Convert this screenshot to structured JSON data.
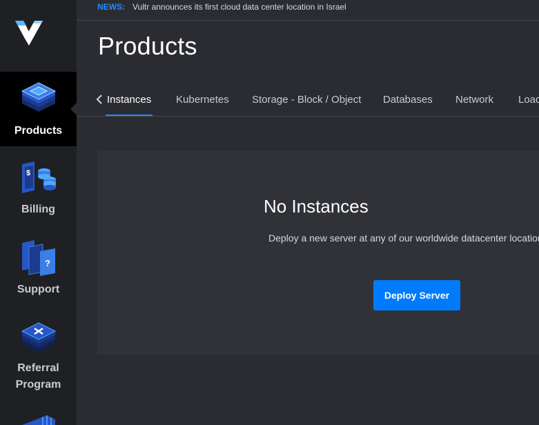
{
  "news": {
    "label": "NEWS:",
    "text": "Vultr announces its first cloud data center location in Israel"
  },
  "page": {
    "title": "Products"
  },
  "sidebar": {
    "items": [
      {
        "label": "Products",
        "icon": "products-stack-icon",
        "active": true
      },
      {
        "label": "Billing",
        "icon": "billing-icon",
        "active": false
      },
      {
        "label": "Support",
        "icon": "support-icon",
        "active": false
      },
      {
        "label": "Referral",
        "label2": "Program",
        "icon": "referral-icon",
        "active": false
      }
    ]
  },
  "tabs": {
    "back_icon": "chevron-left-icon",
    "items": [
      {
        "label": "Instances",
        "active": true
      },
      {
        "label": "Kubernetes"
      },
      {
        "label": "Storage - Block / Object"
      },
      {
        "label": "Databases"
      },
      {
        "label": "Network"
      },
      {
        "label": "Load Balancers"
      }
    ]
  },
  "empty_state": {
    "title": "No Instances",
    "text": "Deploy a new server at any of our worldwide datacenter locations",
    "button_label": "Deploy Server"
  },
  "colors": {
    "accent": "#007bfc",
    "news_label": "#1f8cff",
    "sidebar_bg": "#1f2024",
    "main_bg": "#2b2c31",
    "panel_bg": "#313237"
  }
}
